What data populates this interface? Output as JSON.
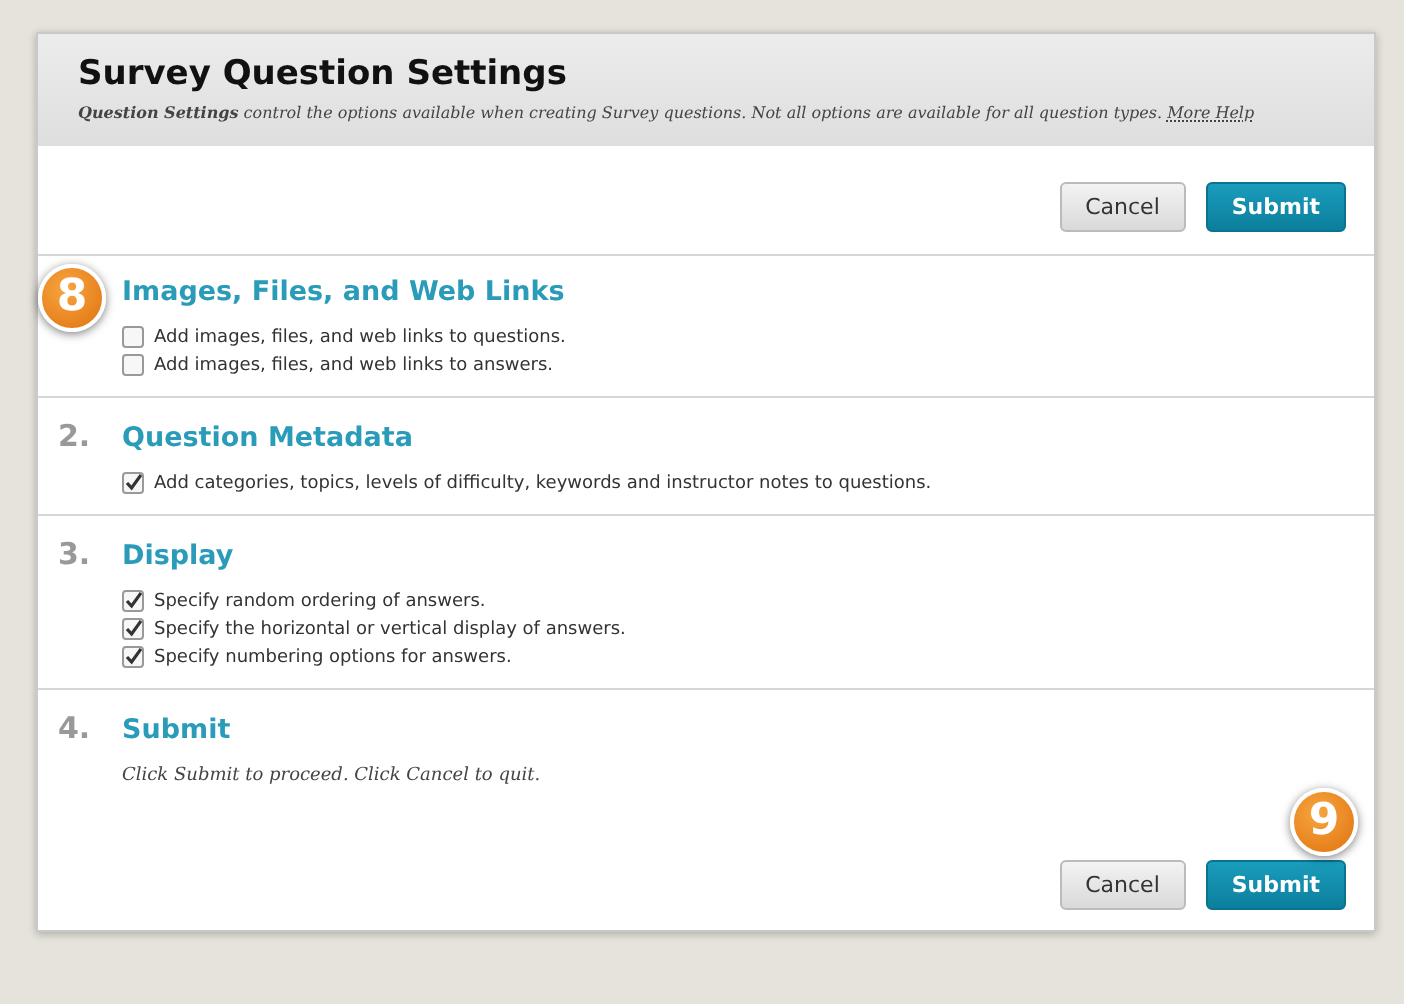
{
  "header": {
    "title": "Survey Question Settings",
    "description": "**Question Settings** control the options available when creating Survey questions. Not all options are available for all question types.",
    "help_link": "More Help"
  },
  "top_buttons": {
    "cancel": "Cancel",
    "submit": "Submit"
  },
  "sections": [
    {
      "title": "Images, Files, and Web Links",
      "callout": "8",
      "options": [
        {
          "label": "Add images, files, and web links to questions.",
          "checked": false
        },
        {
          "label": "Add images, files, and web links to answers.",
          "checked": false
        }
      ]
    },
    {
      "number": "2.",
      "title": "Question Metadata",
      "options": [
        {
          "label": "Add categories, topics, levels of difficulty, keywords and instructor notes to questions.",
          "checked": true
        }
      ]
    },
    {
      "number": "3.",
      "title": "Display",
      "options": [
        {
          "label": "Specify random ordering of answers.",
          "checked": true
        },
        {
          "label": "Specify the horizontal or vertical display of answers.",
          "checked": true
        },
        {
          "label": "Specify numbering options for answers.",
          "checked": true
        }
      ]
    },
    {
      "number": "4.",
      "title": "Submit",
      "note": "Click Submit to proceed. Click Cancel to quit."
    }
  ],
  "bottom_buttons": {
    "cancel": "Cancel",
    "submit": "Submit",
    "callout": "9"
  }
}
